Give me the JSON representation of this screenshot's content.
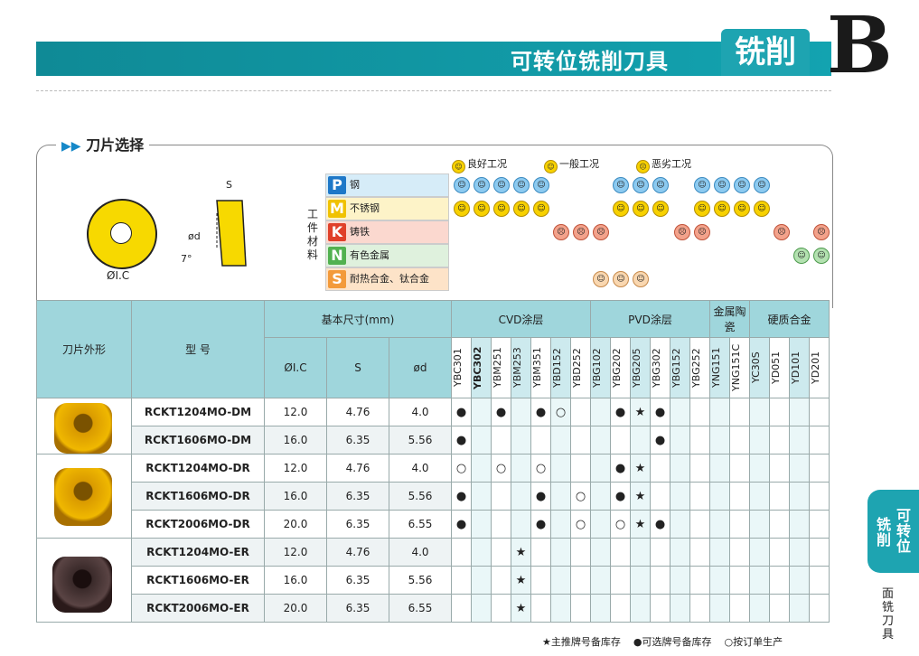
{
  "header": {
    "title": "可转位铣削刀具",
    "category": "铣削",
    "letter": "B"
  },
  "section": {
    "title": "刀片选择"
  },
  "diagram": {
    "s": "S",
    "d": "ød",
    "ic": "ØI.C",
    "angle": "7°"
  },
  "legend": [
    {
      "label": "良好工况"
    },
    {
      "label": "一般工况"
    },
    {
      "label": "恶劣工况"
    }
  ],
  "materials_label": "工件材料",
  "materials": [
    {
      "letter": "P",
      "name": "钢",
      "color": "#1e78c8",
      "bg": "#d6ecf8"
    },
    {
      "letter": "M",
      "name": "不锈钢",
      "color": "#f0c200",
      "bg": "#fdf3c8"
    },
    {
      "letter": "K",
      "name": "铸铁",
      "color": "#e0402a",
      "bg": "#fbd8cf"
    },
    {
      "letter": "N",
      "name": "有色金属",
      "color": "#52b150",
      "bg": "#dff1dd"
    },
    {
      "letter": "S",
      "name": "耐热合金、钛合金",
      "color": "#f39a3a",
      "bg": "#fde3c8"
    }
  ],
  "table": {
    "h_shape": "刀片外形",
    "h_model": "型 号",
    "h_dims": "基本尺寸(mm)",
    "h_ic": "ØI.C",
    "h_s": "S",
    "h_d": "ød",
    "groups": [
      "CVD涂层",
      "PVD涂层",
      "金属陶瓷",
      "硬质合金"
    ],
    "grades": [
      "YBC301",
      "YBC302",
      "YBM251",
      "YBM253",
      "YBM351",
      "YBD152",
      "YBD252",
      "YBG102",
      "YBG202",
      "YBG205",
      "YBG302",
      "YBG152",
      "YBG252",
      "YNG151",
      "YNG151C",
      "YC30S",
      "YD051",
      "YD101",
      "YD201"
    ],
    "rows": [
      {
        "model": "RCKT1204MO-DM",
        "ic": "12.0",
        "s": "4.76",
        "d": "4.0",
        "marks": [
          "●",
          "",
          "●",
          "",
          "●",
          "○",
          "",
          "",
          "●",
          "★",
          "●",
          "",
          "",
          "",
          "",
          "",
          "",
          "",
          ""
        ]
      },
      {
        "model": "RCKT1606MO-DM",
        "ic": "16.0",
        "s": "6.35",
        "d": "5.56",
        "marks": [
          "●",
          "",
          "",
          "",
          "",
          "",
          "",
          "",
          "",
          "",
          "●",
          "",
          "",
          "",
          "",
          "",
          "",
          "",
          ""
        ]
      },
      {
        "model": "RCKT1204MO-DR",
        "ic": "12.0",
        "s": "4.76",
        "d": "4.0",
        "marks": [
          "○",
          "",
          "○",
          "",
          "○",
          "",
          "",
          "",
          "●",
          "★",
          "",
          "",
          "",
          "",
          "",
          "",
          "",
          "",
          ""
        ]
      },
      {
        "model": "RCKT1606MO-DR",
        "ic": "16.0",
        "s": "6.35",
        "d": "5.56",
        "marks": [
          "●",
          "",
          "",
          "",
          "●",
          "",
          "○",
          "",
          "●",
          "★",
          "",
          "",
          "",
          "",
          "",
          "",
          "",
          "",
          ""
        ]
      },
      {
        "model": "RCKT2006MO-DR",
        "ic": "20.0",
        "s": "6.35",
        "d": "6.55",
        "marks": [
          "●",
          "",
          "",
          "",
          "●",
          "",
          "○",
          "",
          "○",
          "★",
          "●",
          "",
          "",
          "",
          "",
          "",
          "",
          "",
          ""
        ]
      },
      {
        "model": "RCKT1204MO-ER",
        "ic": "12.0",
        "s": "4.76",
        "d": "4.0",
        "marks": [
          "",
          "",
          "",
          "★",
          "",
          "",
          "",
          "",
          "",
          "",
          "",
          "",
          "",
          "",
          "",
          "",
          "",
          "",
          ""
        ]
      },
      {
        "model": "RCKT1606MO-ER",
        "ic": "16.0",
        "s": "6.35",
        "d": "5.56",
        "marks": [
          "",
          "",
          "",
          "★",
          "",
          "",
          "",
          "",
          "",
          "",
          "",
          "",
          "",
          "",
          "",
          "",
          "",
          "",
          ""
        ]
      },
      {
        "model": "RCKT2006MO-ER",
        "ic": "20.0",
        "s": "6.35",
        "d": "6.55",
        "marks": [
          "",
          "",
          "",
          "★",
          "",
          "",
          "",
          "",
          "",
          "",
          "",
          "",
          "",
          "",
          "",
          "",
          "",
          "",
          ""
        ]
      }
    ]
  },
  "footer": {
    "star": "★主推牌号备库存",
    "dot": "●可选牌号备库存",
    "circle": "○按订单生产"
  },
  "side_tab": {
    "a": "铣削",
    "b": "可转位",
    "sub": "面铣刀具"
  }
}
